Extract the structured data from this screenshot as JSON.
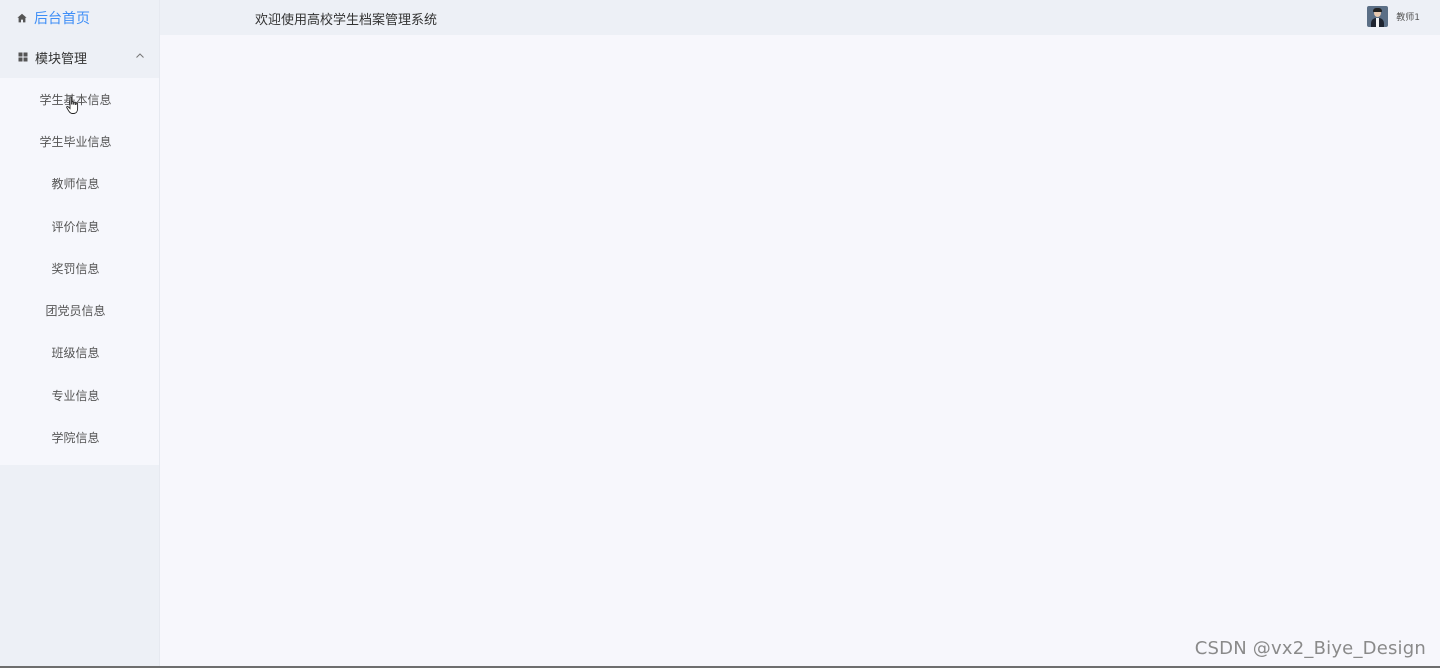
{
  "sidebar": {
    "home": {
      "label": "后台首页",
      "icon": "home-icon"
    },
    "module": {
      "label": "模块管理",
      "icon": "grid-icon",
      "expanded": true
    },
    "items": [
      {
        "label": "学生基本信息"
      },
      {
        "label": "学生毕业信息"
      },
      {
        "label": "教师信息"
      },
      {
        "label": "评价信息"
      },
      {
        "label": "奖罚信息"
      },
      {
        "label": "团党员信息"
      },
      {
        "label": "班级信息"
      },
      {
        "label": "专业信息"
      },
      {
        "label": "学院信息"
      }
    ]
  },
  "header": {
    "welcome": "欢迎使用高校学生档案管理系统",
    "user": {
      "name": "教师1"
    }
  },
  "watermark": "CSDN @vx2_Biye_Design",
  "colors": {
    "accent": "#3e8ef7",
    "sidebar_bg": "#edf0f6",
    "submenu_bg": "#f6f7fc",
    "main_bg": "#f7f7fc"
  }
}
